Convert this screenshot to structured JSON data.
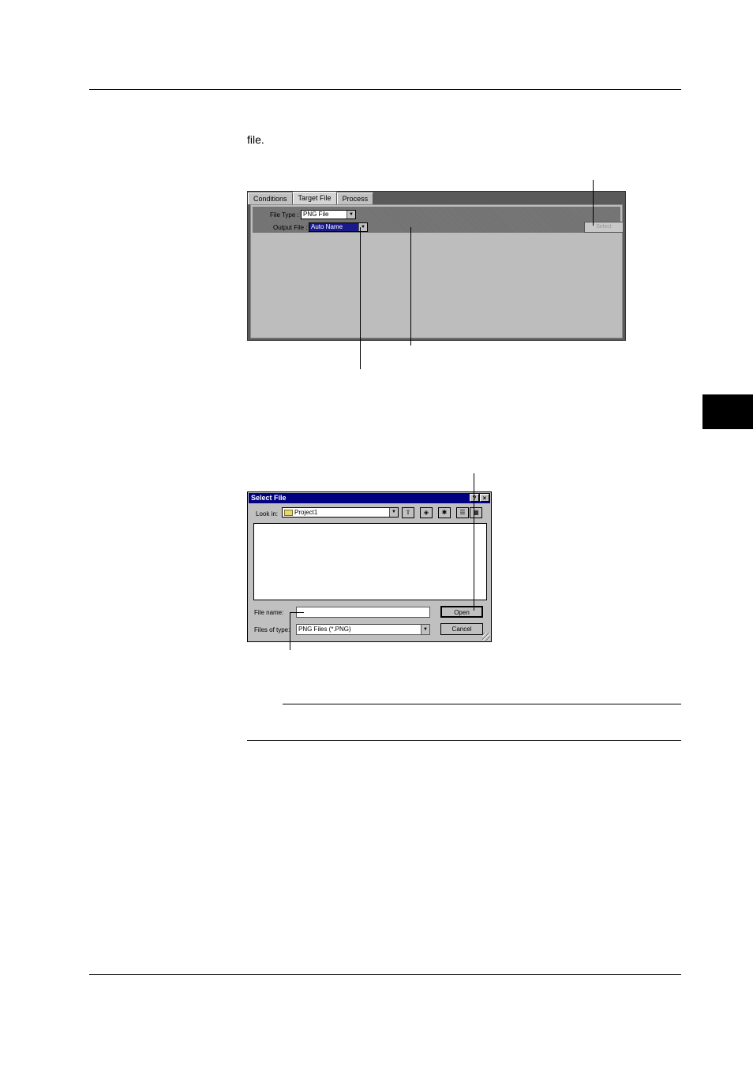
{
  "body_text": "file.",
  "target_panel": {
    "tabs": [
      "Conditions",
      "Target File",
      "Process"
    ],
    "active_tab": "Target File",
    "file_type_label": "File Type :",
    "file_type_value": "PNG File",
    "output_file_label": "Output File :",
    "output_file_value": "Auto Name",
    "select_button": "Select"
  },
  "dialog": {
    "title": "Select File",
    "help_button": "?",
    "close_button": "×",
    "look_in_label": "Look in:",
    "look_in_value": "Project1",
    "file_name_label": "File name:",
    "file_name_value": "",
    "files_of_type_label": "Files of type:",
    "files_of_type_value": "PNG Files (*.PNG)",
    "open_button": "Open",
    "cancel_button": "Cancel"
  }
}
